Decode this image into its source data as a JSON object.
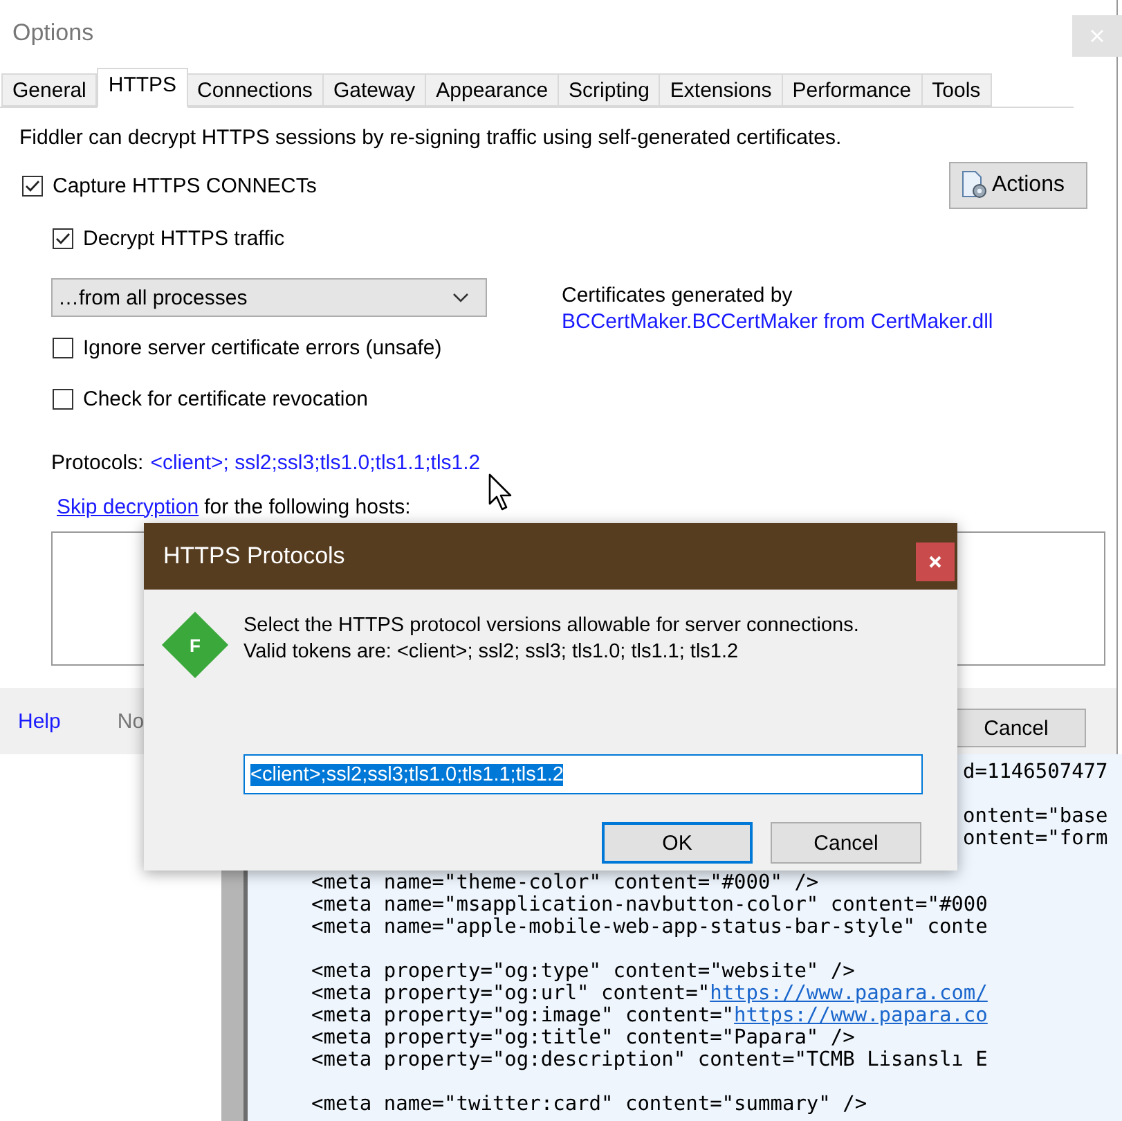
{
  "options_window": {
    "title": "Options",
    "tabs": [
      {
        "label": "General",
        "selected": false
      },
      {
        "label": "HTTPS",
        "selected": true
      },
      {
        "label": "Connections",
        "selected": false
      },
      {
        "label": "Gateway",
        "selected": false
      },
      {
        "label": "Appearance",
        "selected": false
      },
      {
        "label": "Scripting",
        "selected": false
      },
      {
        "label": "Extensions",
        "selected": false
      },
      {
        "label": "Performance",
        "selected": false
      },
      {
        "label": "Tools",
        "selected": false
      }
    ],
    "intro": "Fiddler can decrypt HTTPS sessions by re-signing traffic using self-generated certificates.",
    "capture_connects": {
      "label": "Capture HTTPS CONNECTs",
      "checked": true
    },
    "actions_button": "Actions",
    "decrypt_traffic": {
      "label": "Decrypt HTTPS traffic",
      "checked": true
    },
    "process_filter": {
      "value": "…from all processes"
    },
    "certificates": {
      "label": "Certificates generated by",
      "link": "BCCertMaker.BCCertMaker from CertMaker.dll"
    },
    "options": [
      {
        "label": "Ignore server certificate errors (unsafe)",
        "checked": false
      },
      {
        "label": "Check for certificate revocation",
        "checked": false
      }
    ],
    "protocols": {
      "label": "Protocols:",
      "value": "<client>; ssl2;ssl3;tls1.0;tls1.1;tls1.2"
    },
    "skip": {
      "link": "Skip decryption",
      "text": "for the following hosts:"
    },
    "footer": {
      "help": "Help",
      "note": "No",
      "cancel": "Cancel"
    }
  },
  "code_lines": [
    {
      "kind": "tail",
      "text": "d=1146507477"
    },
    {
      "kind": "gap"
    },
    {
      "kind": "tail",
      "text": "ontent=\"base"
    },
    {
      "kind": "tail",
      "text": "ontent=\"form"
    },
    {
      "kind": "gap"
    },
    {
      "kind": "full",
      "text": "<meta name=\"theme-color\" content=\"#000\" />"
    },
    {
      "kind": "full",
      "text": "<meta name=\"msapplication-navbutton-color\" content=\"#000"
    },
    {
      "kind": "full",
      "text": "<meta name=\"apple-mobile-web-app-status-bar-style\" conte"
    },
    {
      "kind": "gap"
    },
    {
      "kind": "full",
      "text": "<meta property=\"og:type\" content=\"website\" />"
    },
    {
      "kind": "full",
      "text": "<meta property=\"og:url\" content=\"",
      "link": "https://www.papara.com/"
    },
    {
      "kind": "full",
      "text": "<meta property=\"og:image\" content=\"",
      "link": "https://www.papara.co"
    },
    {
      "kind": "full",
      "text": "<meta property=\"og:title\" content=\"Papara\" />"
    },
    {
      "kind": "full",
      "text": "<meta property=\"og:description\" content=\"TCMB Lisanslı E"
    },
    {
      "kind": "gap"
    },
    {
      "kind": "full",
      "text": "<meta name=\"twitter:card\" content=\"summary\" />"
    }
  ],
  "dialog": {
    "title": "HTTPS Protocols",
    "logo": "F",
    "message": [
      "Select the HTTPS protocol versions allowable for server connections.",
      "Valid tokens are: <client>; ssl2; ssl3; tls1.0; tls1.1; tls1.2"
    ],
    "value": "<client>;ssl2;ssl3;tls1.0;tls1.1;tls1.2",
    "buttons": [
      {
        "label": "OK",
        "selected": true
      },
      {
        "label": "Cancel",
        "selected": false
      }
    ]
  }
}
